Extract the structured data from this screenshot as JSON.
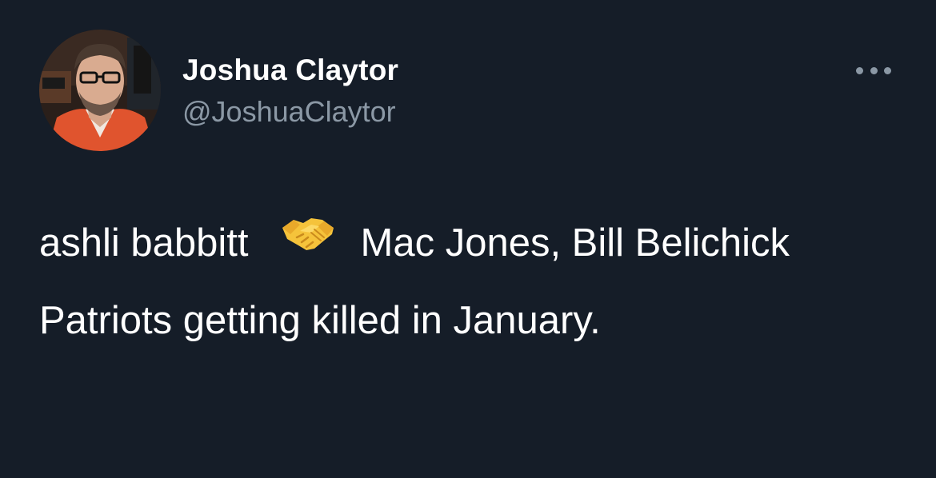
{
  "tweet": {
    "author_name": "Joshua Claytor",
    "author_handle": "@JoshuaClaytor",
    "text_line1_before_emoji": "ashli babbitt",
    "emoji": "handshake-emoji",
    "text_line1_after_emoji": "Mac Jones, Bill Belichick",
    "text_line2": "Patriots getting killed in January."
  },
  "icons": {
    "more": "more-horizontal-icon",
    "avatar": "profile-photo"
  },
  "colors": {
    "background": "#151d28",
    "text_primary": "#ffffff",
    "text_secondary": "#8b98a5",
    "emoji_skin": "#f5c33b"
  }
}
